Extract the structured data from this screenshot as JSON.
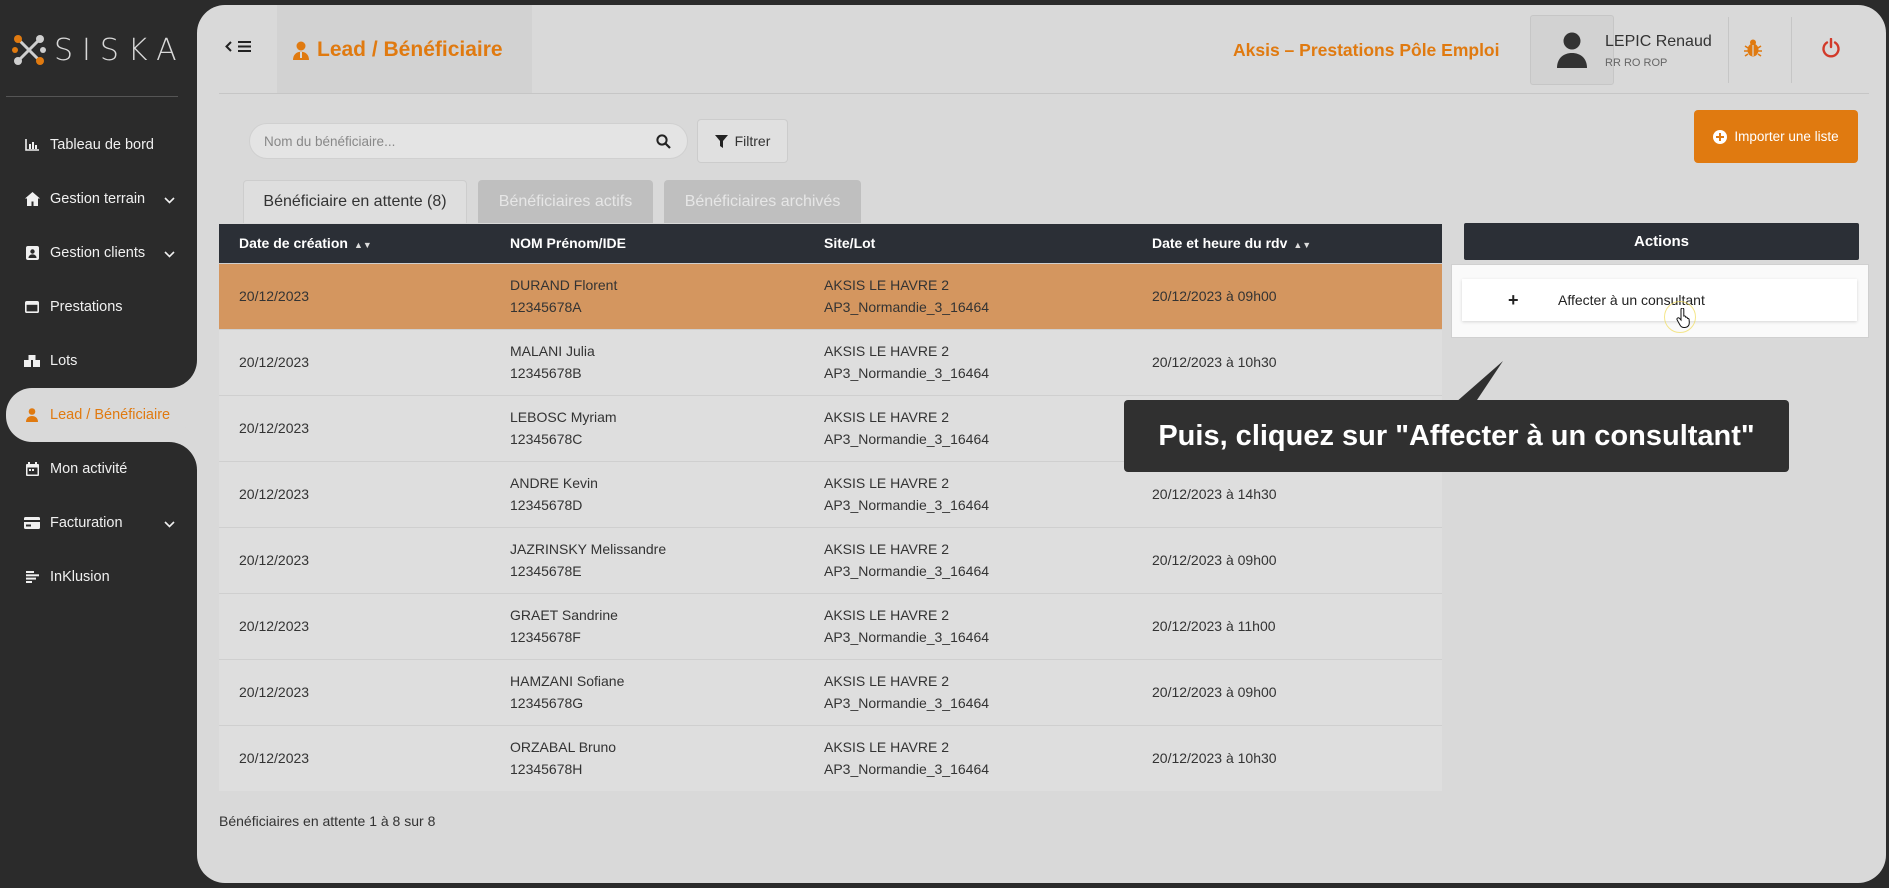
{
  "app": {
    "logo_text": "SISKA"
  },
  "sidebar": {
    "items": [
      {
        "label": "Tableau de bord",
        "icon": "chart-icon"
      },
      {
        "label": "Gestion terrain",
        "icon": "home-icon",
        "has_chevron": true
      },
      {
        "label": "Gestion clients",
        "icon": "badge-icon",
        "has_chevron": true
      },
      {
        "label": "Prestations",
        "icon": "window-icon"
      },
      {
        "label": "Lots",
        "icon": "boxes-icon"
      },
      {
        "label": "Lead / Bénéficiaire",
        "icon": "user-icon",
        "active": true
      },
      {
        "label": "Mon activité",
        "icon": "calendar-icon"
      },
      {
        "label": "Facturation",
        "icon": "card-icon",
        "has_chevron": true
      },
      {
        "label": "InKlusion",
        "icon": "list-icon"
      }
    ]
  },
  "header": {
    "page_title": "Lead / Bénéficiaire",
    "org_name": "Aksis – Prestations Pôle Emploi",
    "user_name": "LEPIC Renaud",
    "user_role": "RR RO ROP"
  },
  "toolbar": {
    "search_placeholder": "Nom du bénéficiaire...",
    "filter_label": "Filtrer",
    "import_label": "Importer une liste"
  },
  "tabs": [
    {
      "label": "Bénéficiaire en attente (8)",
      "active": true
    },
    {
      "label": "Bénéficiaires actifs",
      "active": false
    },
    {
      "label": "Bénéficiaires archivés",
      "active": false
    }
  ],
  "table": {
    "columns": [
      "Date de création",
      "NOM Prénom/IDE",
      "Site/Lot",
      "Date et heure du rdv"
    ],
    "rows": [
      {
        "created": "20/12/2023",
        "name": "DURAND Florent",
        "ide": "12345678A",
        "site": "AKSIS LE HAVRE 2",
        "lot": "AP3_Normandie_3_16464",
        "rdv": "20/12/2023 à 09h00",
        "highlighted": true
      },
      {
        "created": "20/12/2023",
        "name": "MALANI Julia",
        "ide": "12345678B",
        "site": "AKSIS LE HAVRE 2",
        "lot": "AP3_Normandie_3_16464",
        "rdv": "20/12/2023 à 10h30"
      },
      {
        "created": "20/12/2023",
        "name": "LEBOSC Myriam",
        "ide": "12345678C",
        "site": "AKSIS LE HAVRE 2",
        "lot": "AP3_Normandie_3_16464",
        "rdv": ""
      },
      {
        "created": "20/12/2023",
        "name": "ANDRE Kevin",
        "ide": "12345678D",
        "site": "AKSIS LE HAVRE 2",
        "lot": "AP3_Normandie_3_16464",
        "rdv": "20/12/2023 à 14h30"
      },
      {
        "created": "20/12/2023",
        "name": "JAZRINSKY Melissandre",
        "ide": "12345678E",
        "site": "AKSIS LE HAVRE 2",
        "lot": "AP3_Normandie_3_16464",
        "rdv": "20/12/2023 à 09h00"
      },
      {
        "created": "20/12/2023",
        "name": "GRAET Sandrine",
        "ide": "12345678F",
        "site": "AKSIS LE HAVRE 2",
        "lot": "AP3_Normandie_3_16464",
        "rdv": "20/12/2023 à 11h00"
      },
      {
        "created": "20/12/2023",
        "name": "HAMZANI Sofiane",
        "ide": "12345678G",
        "site": "AKSIS LE HAVRE 2",
        "lot": "AP3_Normandie_3_16464",
        "rdv": "20/12/2023 à 09h00"
      },
      {
        "created": "20/12/2023",
        "name": "ORZABAL Bruno",
        "ide": "12345678H",
        "site": "AKSIS LE HAVRE 2",
        "lot": "AP3_Normandie_3_16464",
        "rdv": "20/12/2023 à 10h30"
      }
    ],
    "footer": "Bénéficiaires en attente 1 à 8 sur 8"
  },
  "actions": {
    "header": "Actions",
    "menu_item": "Affecter à un consultant"
  },
  "tooltip": {
    "text": "Puis, cliquez sur \"Affecter à un consultant\""
  },
  "colors": {
    "accent": "#e07a10",
    "highlight_row": "#d4965f",
    "header_dark": "#2b2f36",
    "sidebar_bg": "#2b2b2b",
    "power_red": "#d23a2a"
  }
}
